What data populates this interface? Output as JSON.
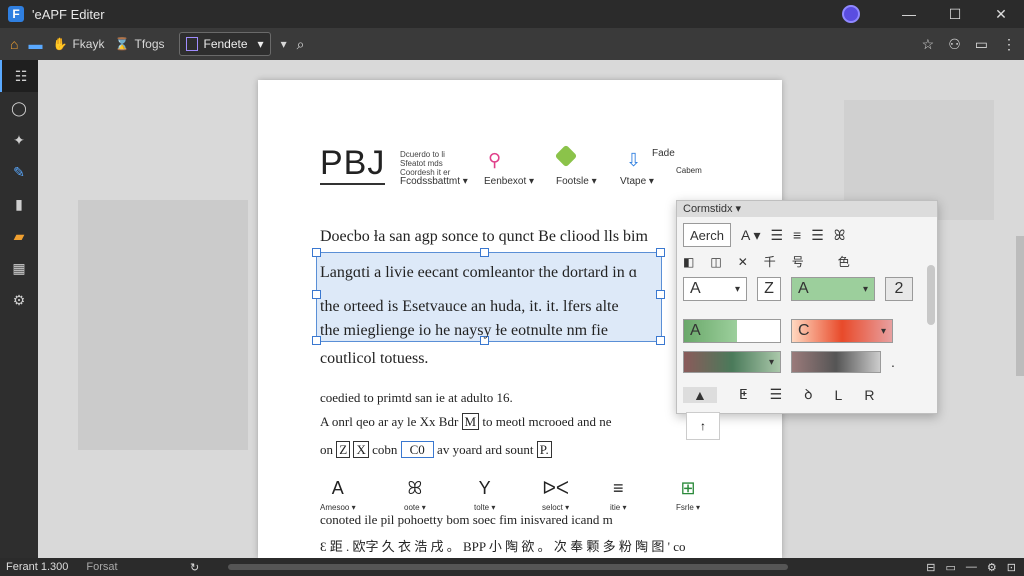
{
  "app": {
    "title": "'eAPF Editer",
    "logo_glyph": "F"
  },
  "toolbar": {
    "item1": "Fkayk",
    "item2": "Tfogs",
    "dropdown": "Fendete",
    "dropdown_caret": "▾",
    "extra_caret": "▾"
  },
  "sidebar": {
    "icons": [
      "list-icon",
      "lasso-icon",
      "magic-icon",
      "pen-icon",
      "bookmark-icon",
      "folder-icon",
      "grid-icon",
      "gear-icon"
    ]
  },
  "document": {
    "logo": "PBJ",
    "logo_small": [
      "Dcuerdo to li",
      "Sfeatot mds",
      "Coordesh it er"
    ],
    "ribbon": [
      {
        "label": "Fcodssbattmt ▾"
      },
      {
        "label": "Eenbexot ▾"
      },
      {
        "label": "Footsle ▾"
      },
      {
        "label": "Vtape ▾"
      }
    ],
    "ribbon_note1": "Fade",
    "ribbon_note2": "Cabem",
    "lines": [
      "Doecbo ɫa san agp sonce to qunct Be cliood lls bim",
      "Langɑti a livie eecant comleantor the dortard in ɑ",
      "the orteed is Esetvauce an huda, it. it. lfers alte",
      "the mieglienge io he naysy ɫe eotnulte nm fie",
      "coutlicol totuess."
    ],
    "small_lines": [
      "coedied to primtd san ie at adulto 16.",
      "to meotl mcrooed and ne",
      "av yoard ard sount",
      "conoted ile pil pohoetty bom soec fim inisvared icand m",
      "Ɛ 距 . 欧字 久 衣 浩 戌 。 BPP 小 陶 欲 。 次 奉 颗 多 粉 陶 图 ' co"
    ],
    "mid_frag1": "A onrl qeo ar ay le Xx Bdr",
    "box_M": "M",
    "mid_frag2": "on",
    "box_z": "Z",
    "box_x": "X",
    "frag_cobn": "cobn",
    "box_co": "C0",
    "frag_end": "P.",
    "bottom_icons": [
      {
        "glyph": "A",
        "label": "Amesoo ▾"
      },
      {
        "glyph": "ꕤ",
        "label": "oote ▾"
      },
      {
        "glyph": "Y",
        "label": "tolte ▾"
      },
      {
        "glyph": "ᐅᐸ",
        "label": "seloct ▾"
      },
      {
        "glyph": "≡",
        "label": "itie ▾"
      },
      {
        "glyph": "⊞",
        "label": "Fsrle ▾"
      }
    ]
  },
  "panel": {
    "title": "Cormstidx ▾",
    "font_field": "Aerch",
    "font_caret": "A ▾",
    "row2_labels": [
      "✕",
      "千",
      "号",
      "色"
    ],
    "font_size": "A",
    "size_caret": "▾",
    "strike": "Z",
    "color_field": "A",
    "color_caret": "▾",
    "line_spacing": "2",
    "swatch_a": "A",
    "swatch_c": "C",
    "swatch_c_caret": "▾",
    "swatch_ml_caret": "▾",
    "dot": ".",
    "bottom_row": [
      "▲",
      "ⵟ",
      "☰",
      "ꝺ",
      "L",
      "R"
    ],
    "up_arrow": "↑"
  },
  "status": {
    "left": "Ferant 1.300",
    "format": "Forsat",
    "right_items": [
      "⊟",
      "▭",
      "—",
      "⚙",
      "⊡"
    ]
  },
  "colors": {
    "accent": "#3a78d0",
    "bar": "#2b2b2b",
    "selection": "#dde9f8"
  }
}
